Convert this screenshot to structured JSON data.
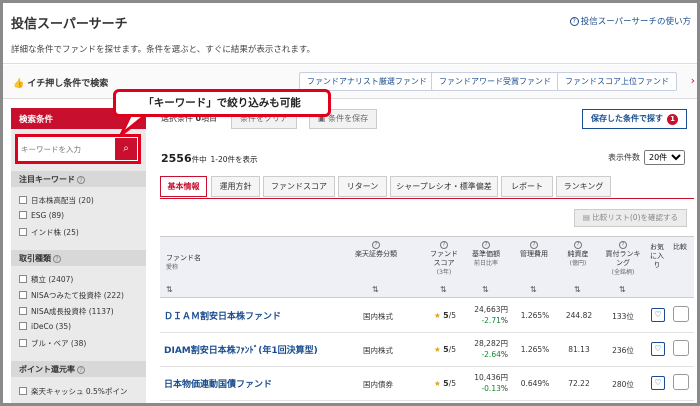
{
  "header": {
    "title": "投信スーパーサーチ",
    "help_link": "投信スーパーサーチの使い方",
    "description": "詳細な条件でファンドを探せます。条件を選ぶと、すぐに結果が表示されます。"
  },
  "quick_filter": {
    "label": "イチ押し条件で検索",
    "chips": [
      "ファンドアナリスト厳選ファンド",
      "ファンドアワード受賞ファンド",
      "ファンドスコア上位ファンド"
    ]
  },
  "callout": {
    "text": "「キーワード」で絞り込みも可能"
  },
  "sidebar": {
    "header": "検索条件",
    "search_placeholder": "キーワードを入力",
    "sections": [
      {
        "title": "注目キーワード",
        "items": [
          "日本株高配当 (20)",
          "ESG (89)",
          "インド株 (25)"
        ]
      },
      {
        "title": "取引種類",
        "items": [
          "積立 (2407)",
          "NISAつみたて投資枠 (222)",
          "NISA成長投資枠 (1137)",
          "iDeCo (35)",
          "ブル・ベア (38)"
        ]
      },
      {
        "title": "ポイント還元率",
        "items": [
          "楽天キャッシュ 0.5%ポイン"
        ]
      }
    ]
  },
  "toolbar": {
    "conditions_count": "0",
    "conditions_prefix": "選択条件",
    "conditions_suffix": "項目",
    "clear_label": "条件をクリア",
    "save_label": "条件を保存",
    "saved_label": "保存した条件で探す",
    "saved_count": "1"
  },
  "results": {
    "total": "2556",
    "total_unit": "件中",
    "range_text": "1-20件を表示",
    "per_page_label": "表示件数",
    "per_page_value": "20件"
  },
  "tabs": [
    "基本情報",
    "運用方針",
    "ファンドスコア",
    "リターン",
    "シャープレシオ・標準偏差",
    "レポート",
    "ランキング"
  ],
  "compare_button": "比較リスト(0)を確認する",
  "table": {
    "headers": {
      "fund_name": "ファンド名",
      "fund_name_sub": "愛称",
      "category": "楽天証券分類",
      "score": "ファンドスコア",
      "score_sub": "(3年)",
      "nav": "基準価額",
      "nav_sub": "前日比率",
      "fee": "管理費用",
      "assets": "純資産",
      "assets_sub": "(億円)",
      "ranking": "買付ランキング",
      "ranking_sub": "(全銘柄)",
      "favorite": "お気に入り",
      "compare": "比較"
    },
    "rows": [
      {
        "name": "ＤＩＡＭ割安日本株ファンド",
        "category": "国内株式",
        "score": "5",
        "score_max": "/5",
        "nav": "24,663",
        "nav_unit": "円",
        "change": "-2.71",
        "fee": "1.265",
        "assets": "244.82",
        "rank": "133",
        "rank_unit": "位"
      },
      {
        "name": "DIAM割安日本株ﾌｧﾝﾄﾞ(年1回決算型)",
        "category": "国内株式",
        "score": "5",
        "score_max": "/5",
        "nav": "28,282",
        "nav_unit": "円",
        "change": "-2.64",
        "fee": "1.265",
        "assets": "81.13",
        "rank": "236",
        "rank_unit": "位"
      },
      {
        "name": "日本物価連動国債ファンド",
        "category": "国内債券",
        "score": "5",
        "score_max": "/5",
        "nav": "10,436",
        "nav_unit": "円",
        "change": "-0.13",
        "fee": "0.649",
        "assets": "72.22",
        "rank": "280",
        "rank_unit": "位"
      }
    ]
  },
  "colors": {
    "accent": "#c8102e",
    "link": "#1a4d8f",
    "callout_border": "#e0001c"
  }
}
